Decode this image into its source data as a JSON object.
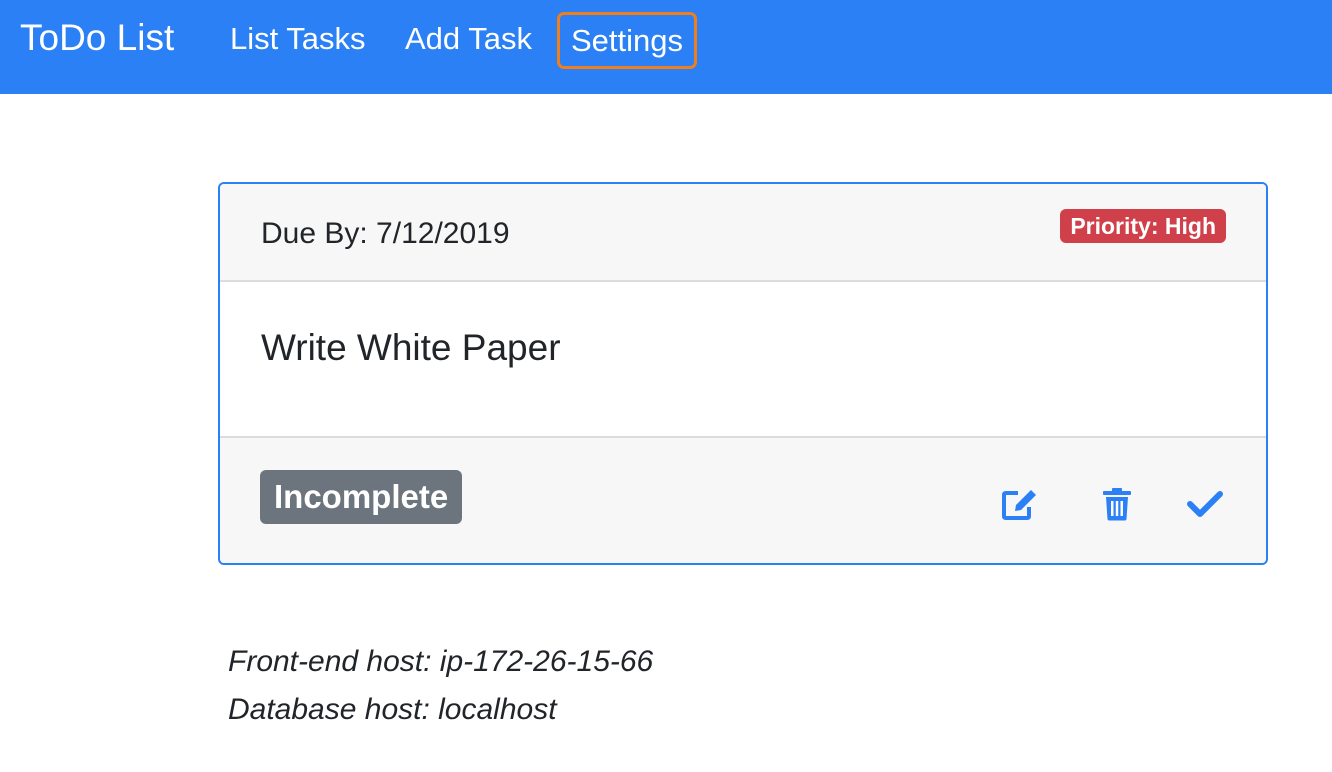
{
  "navbar": {
    "brand": "ToDo List",
    "links": [
      "List Tasks",
      "Add Task",
      "Settings"
    ],
    "background_color": "#2b80f5",
    "focus_outline_color": "#f07e1a"
  },
  "task": {
    "due_label": "Due By: 7/12/2019",
    "priority_label": "Priority: High",
    "priority_color": "#d0404b",
    "title": "Write White Paper",
    "status": "Incomplete",
    "status_color": "#6c757d",
    "actions": [
      "edit-icon",
      "trash-icon",
      "check-icon"
    ],
    "card_border_color": "#2b80f5"
  },
  "footer": {
    "frontend_host": "Front-end host: ip-172-26-15-66",
    "database_host": "Database host: localhost"
  }
}
